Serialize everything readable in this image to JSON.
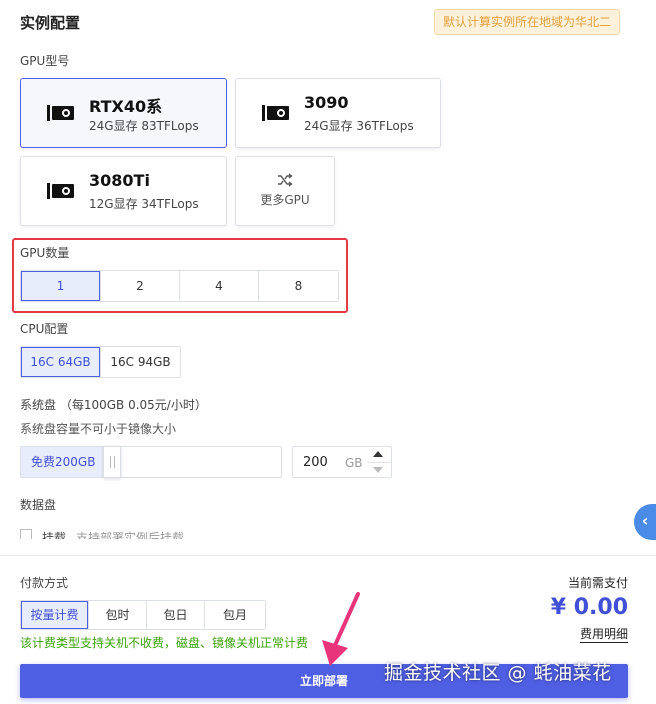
{
  "header": {
    "title": "实例配置",
    "region_notice": "默认计算实例所在地域为华北二"
  },
  "gpu_model": {
    "label": "GPU型号",
    "cards": [
      {
        "name": "RTX40系",
        "spec": "24G显存 83TFLops",
        "selected": true
      },
      {
        "name": "3090",
        "spec": "24G显存 36TFLops",
        "selected": false
      },
      {
        "name": "3080Ti",
        "spec": "12G显存 34TFLops",
        "selected": false
      }
    ],
    "more_label": "更多GPU",
    "icon": "gpu-card-icon",
    "more_icon": "shuffle-icon"
  },
  "gpu_count": {
    "label": "GPU数量",
    "options": [
      "1",
      "2",
      "4",
      "8"
    ],
    "selected": "1"
  },
  "cpu": {
    "label": "CPU配置",
    "options": [
      "16C 64GB",
      "16C 94GB"
    ],
    "selected": "16C 64GB"
  },
  "system_disk": {
    "label": "系统盘 （每100GB 0.05元/小时）",
    "sub_label": "系统盘容量不可小于镜像大小",
    "free_label": "免费200GB",
    "value": "200",
    "unit": "GB"
  },
  "data_disk": {
    "label": "数据盘",
    "mount_label": "挂载",
    "mount_hint": "支持部署实例后挂载"
  },
  "payment": {
    "label": "付款方式",
    "options": [
      "按量计费",
      "包时",
      "包日",
      "包月"
    ],
    "selected": "按量计费",
    "note": "该计费类型支持关机不收费，磁盘、镜像关机正常计费"
  },
  "price": {
    "label": "当前需支付",
    "value": "¥ 0.00",
    "detail_link": "费用明细"
  },
  "actions": {
    "deploy_label": "立即部署"
  },
  "side_tab": {
    "glyph": "‹"
  },
  "watermark": "掘金技术社区 @ 蚝油菜花",
  "colors": {
    "accent": "#4f5fe3",
    "highlight_border": "#e63946",
    "notice_text": "#e3a03b",
    "note_green": "#3ba30b",
    "side_tab": "#4a8be8"
  }
}
